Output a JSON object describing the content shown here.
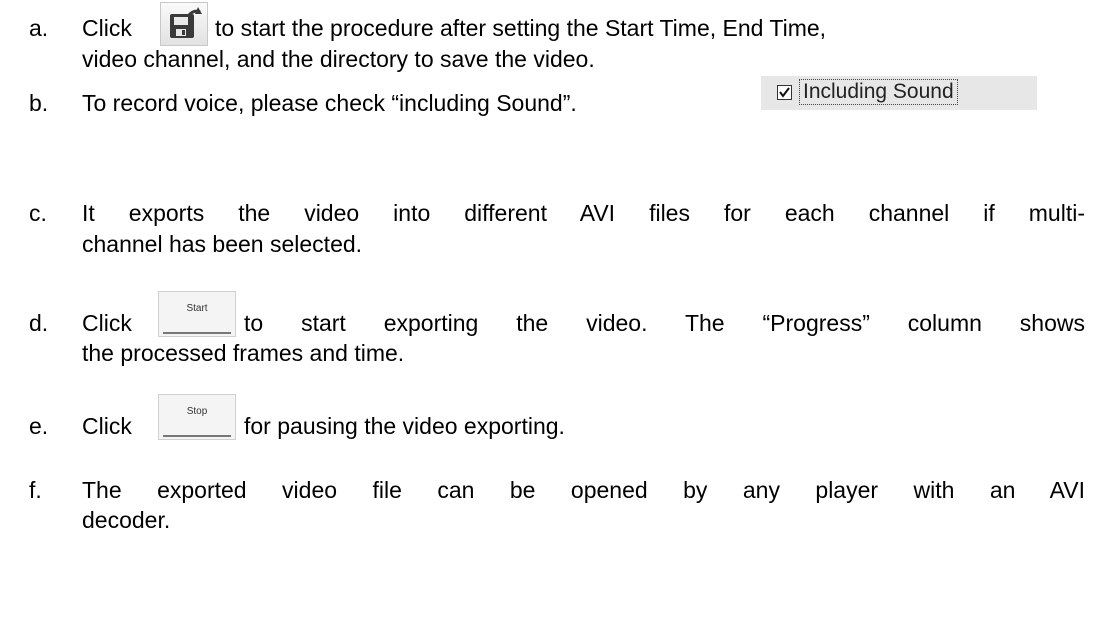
{
  "items": [
    {
      "marker": "a.",
      "pre": "Click",
      "post": "to start the procedure after setting the Start Time, End Time,",
      "cont": "video channel, and the directory to save the video."
    },
    {
      "marker": "b.",
      "text": "To record voice, please check “including Sound”.",
      "widget_label": "Including Sound"
    },
    {
      "marker": "c.",
      "line1": "It exports the video into different AVI files for each channel if multi-",
      "line2": "channel has been selected."
    },
    {
      "marker": "d.",
      "pre": "Click",
      "button_label": "Start",
      "post": "to start exporting the video. The “Progress” column shows",
      "cont": "the processed frames and time."
    },
    {
      "marker": "e.",
      "pre": "Click",
      "button_label": "Stop",
      "post": "for pausing the video exporting."
    },
    {
      "marker": "f.",
      "line1": "The exported video file can be opened by any player with an AVI",
      "line2": "decoder."
    }
  ],
  "icons": {
    "export": "export-video-icon",
    "checkbox": "checkbox-checked-icon"
  }
}
